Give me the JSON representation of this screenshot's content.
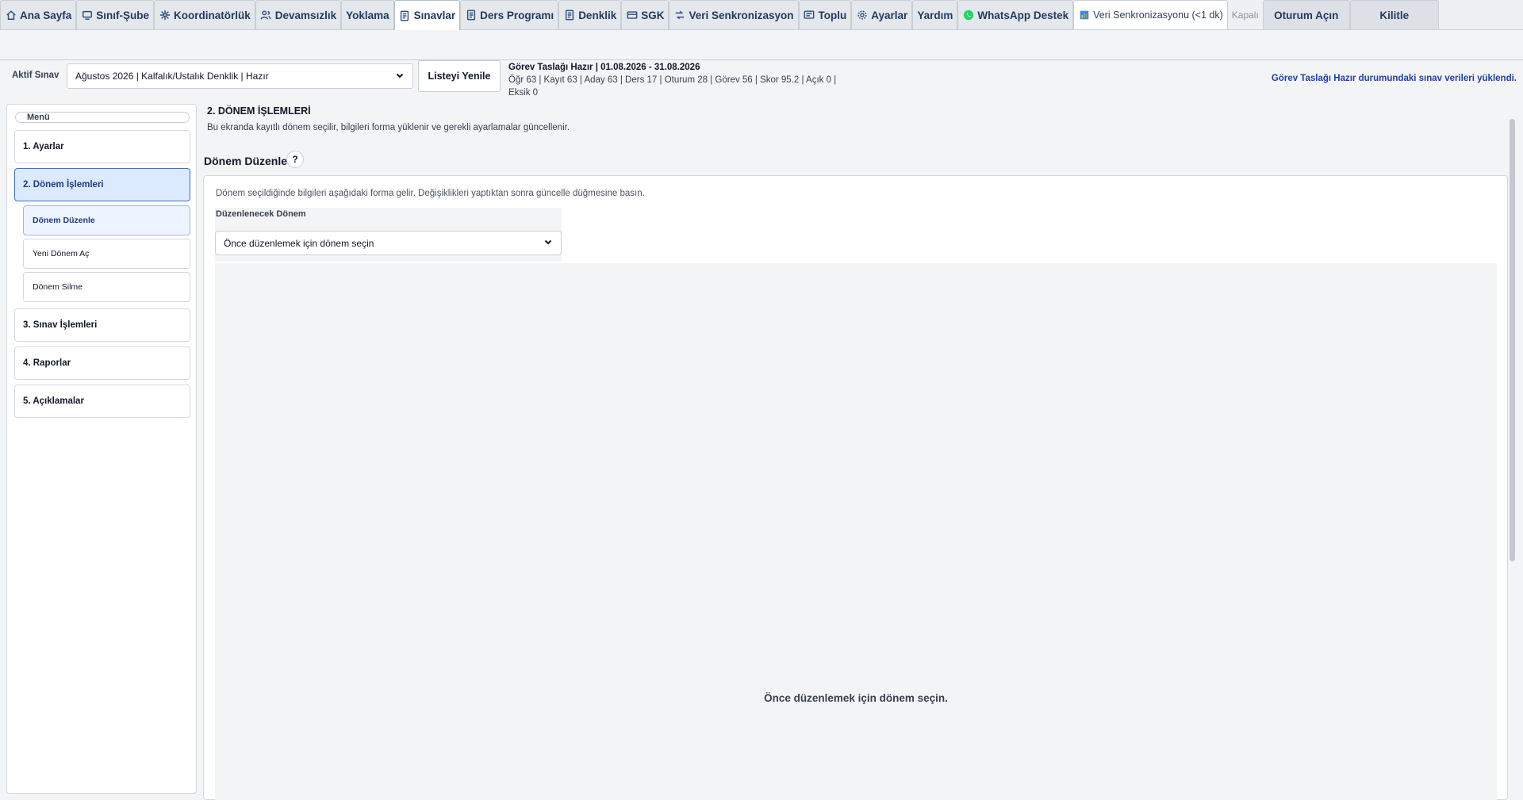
{
  "tabs": [
    {
      "label": "Ana Sayfa",
      "icon": "home-icon"
    },
    {
      "label": "Sınıf-Şube",
      "icon": "classroom-icon"
    },
    {
      "label": "Koordinatörlük",
      "icon": "network-icon"
    },
    {
      "label": "Devamsızlık",
      "icon": "users-icon"
    },
    {
      "label": "Yoklama",
      "icon": ""
    },
    {
      "label": "Sınavlar",
      "icon": "document-icon"
    },
    {
      "label": "Ders Programı",
      "icon": "document-icon"
    },
    {
      "label": "Denklik",
      "icon": "document-icon"
    },
    {
      "label": "SGK",
      "icon": "card-icon"
    },
    {
      "label": "Veri Senkronizasyon",
      "icon": "sync-icon"
    },
    {
      "label": "Toplu",
      "icon": "message-icon"
    },
    {
      "label": "Ayarlar",
      "icon": "gear-icon"
    },
    {
      "label": "Yardım",
      "icon": ""
    },
    {
      "label": "WhatsApp Destek",
      "icon": "whatsapp-icon"
    },
    {
      "label": "Veri Senkronizasyonu (<1 dk)",
      "icon": "chart-icon"
    },
    {
      "label": "Kapalı",
      "icon": ""
    },
    {
      "label": "Oturum Açın",
      "icon": ""
    },
    {
      "label": "Kilitle",
      "icon": ""
    }
  ],
  "controls": {
    "active_exam_label": "Aktif Sınav",
    "active_exam_value": "Ağustos 2026 | Kalfalık/Ustalık Denklik | Hazır",
    "refresh_button": "Listeyi Yenile",
    "info_title": "Görev Taslağı Hazır | 01.08.2026 - 31.08.2026",
    "info_stats": "Öğr 63 | Kayıt 63 | Aday 63 | Ders 17 | Oturum 28 | Görev 56 | Skor 95.2 | Açık 0 |",
    "info_stats2": "Eksik 0",
    "notice": "Görev Taslağı Hazır durumundaki sınav verileri yüklendi."
  },
  "sidebar": {
    "legend": "Menü",
    "items": [
      {
        "label": "1. Ayarlar"
      },
      {
        "label": "2. Dönem İşlemleri"
      },
      {
        "label": "3. Sınav İşlemleri"
      },
      {
        "label": "4. Raporlar"
      },
      {
        "label": "5. Açıklamalar"
      }
    ],
    "subitems": [
      {
        "label": "Dönem Düzenle"
      },
      {
        "label": "Yeni Dönem Aç"
      },
      {
        "label": "Dönem Silme"
      }
    ]
  },
  "main": {
    "section_title": "2. DÖNEM İŞLEMLERİ",
    "section_desc": "Bu ekranda kayıtlı dönem seçilir, bilgileri forma yüklenir ve gerekli ayarlamalar güncellenir.",
    "sub_title": "Dönem Düzenle",
    "help_label": "?",
    "panel_hint": "Dönem seçildiğinde bilgileri aşağıdaki forma gelir. Değişiklikleri yaptıktan sonra güncelle düğmesine basın.",
    "field_label": "Düzenlenecek Dönem",
    "term_select_value": "Önce düzenlemek için dönem seçin",
    "empty_message": "Önce düzenlemek için dönem seçin."
  },
  "colors": {
    "accent": "#1e3a8a",
    "active_bg": "#dbeafe",
    "whatsapp": "#25d366"
  }
}
